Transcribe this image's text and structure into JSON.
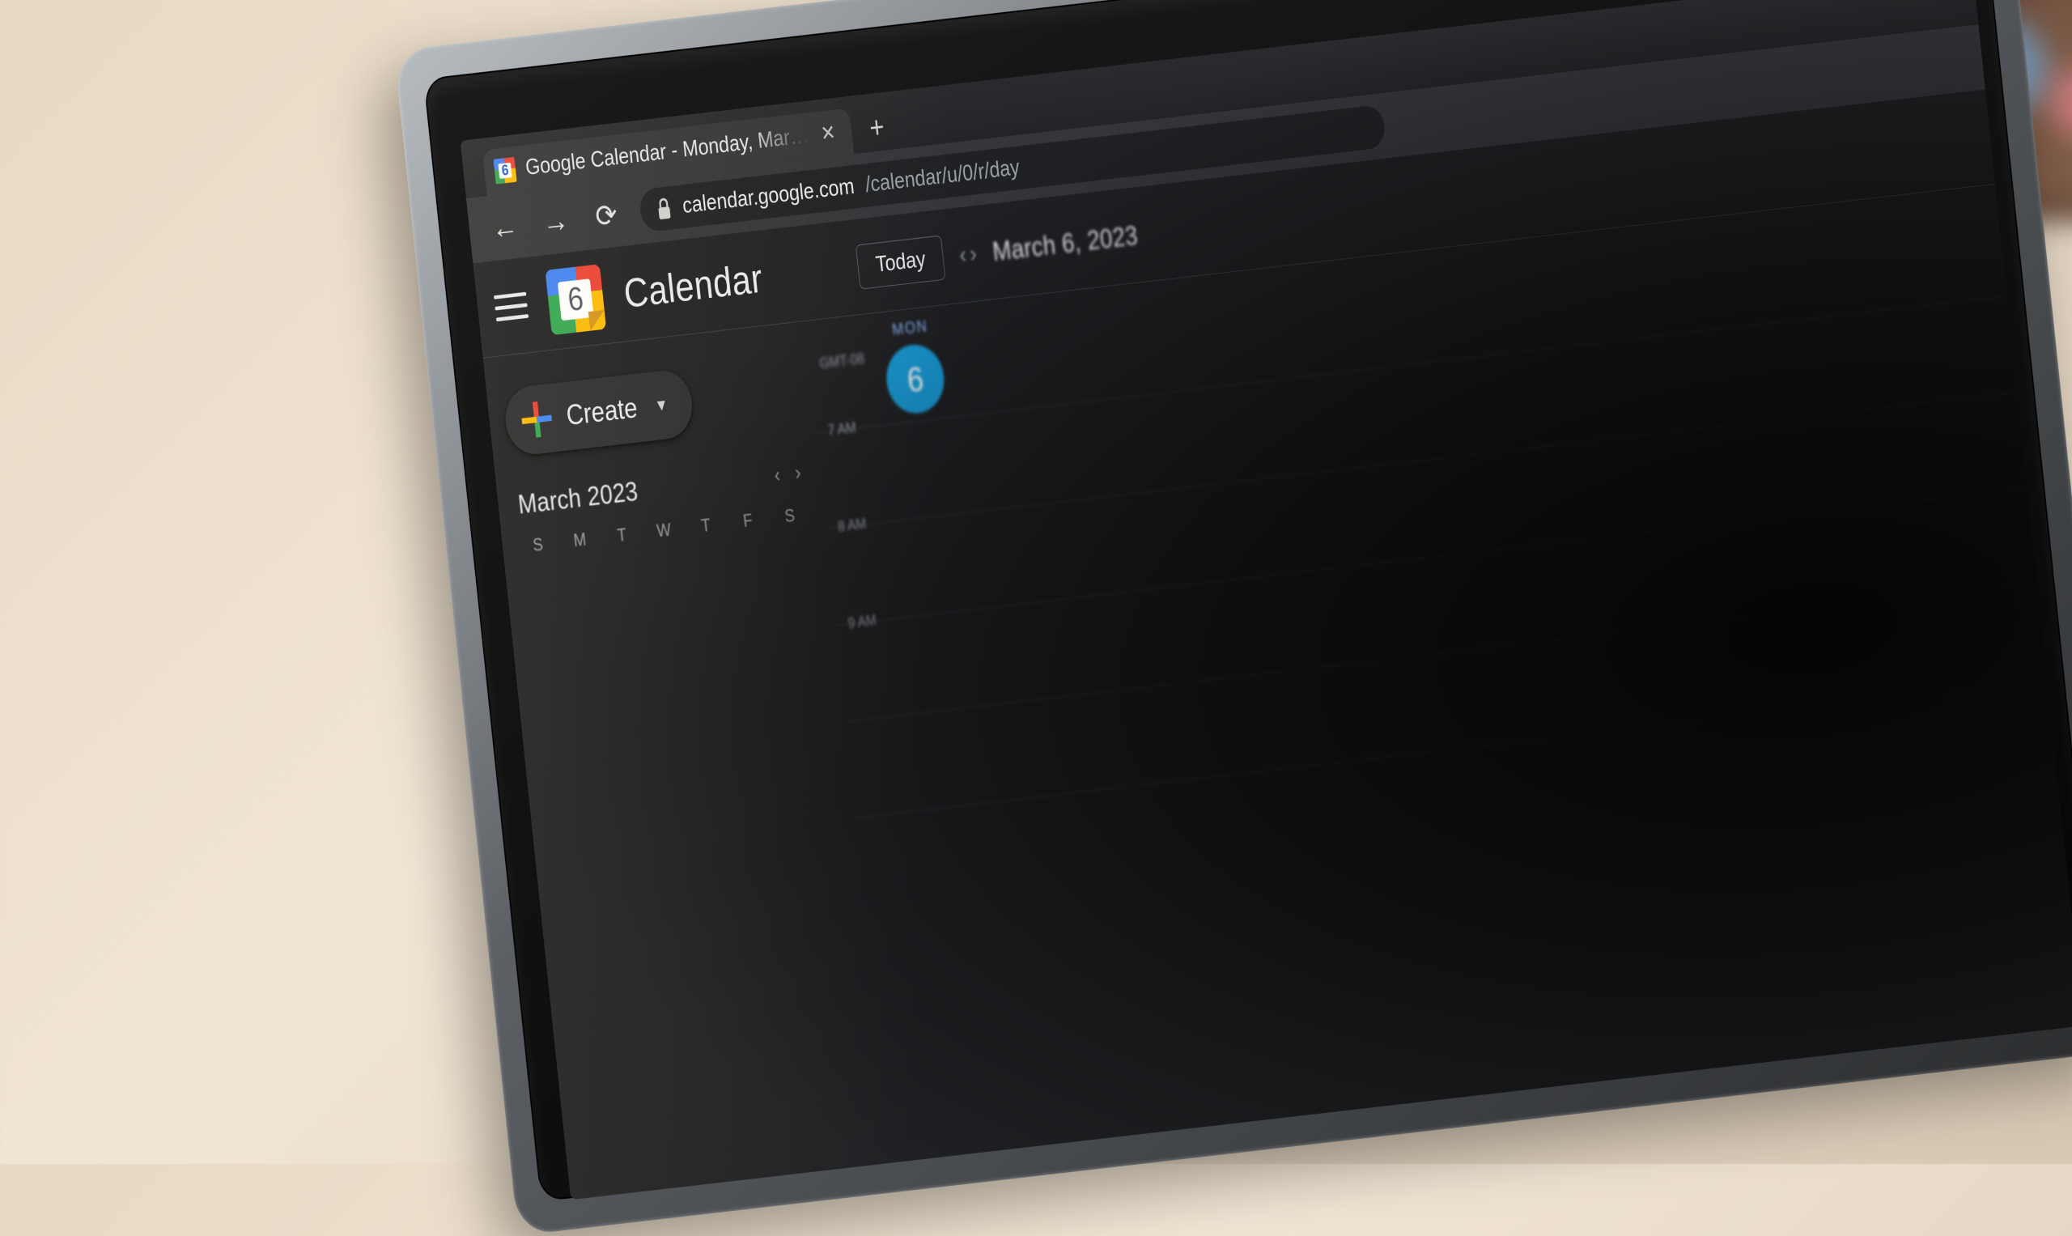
{
  "browser": {
    "tab": {
      "favicon_number": "6",
      "title": "Google Calendar - Monday, Mar…"
    },
    "omnibox": {
      "host": "calendar.google.com",
      "path": "/calendar/u/0/r/day"
    }
  },
  "calendar": {
    "logo_number": "6",
    "app_title": "Calendar",
    "today_label": "Today",
    "current_date_display": "March 6, 2023",
    "create_label": "Create",
    "mini": {
      "month_label": "March 2023",
      "dow": [
        "S",
        "M",
        "T",
        "W",
        "T",
        "F",
        "S"
      ]
    },
    "timezone_label": "GMT-08",
    "day_column": {
      "dow_label": "MON",
      "day_number": "6"
    },
    "hour_labels": [
      "7 AM",
      "8 AM",
      "9 AM"
    ]
  }
}
